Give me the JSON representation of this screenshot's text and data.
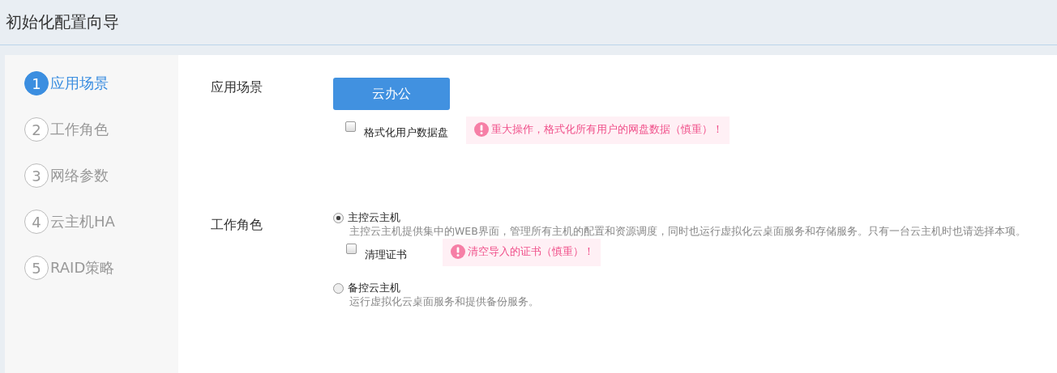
{
  "window": {
    "title": "初始化配置向导"
  },
  "steps": [
    {
      "number": "1",
      "label": "应用场景",
      "selected": true
    },
    {
      "number": "2",
      "label": "工作角色",
      "selected": false
    },
    {
      "number": "3",
      "label": "网络参数",
      "selected": false
    },
    {
      "number": "4",
      "label": "云主机HA",
      "selected": false
    },
    {
      "number": "5",
      "label": "RAID策略",
      "selected": false
    }
  ],
  "sections": [
    {
      "kind": "scene",
      "label": "应用场景",
      "button": "云办公",
      "option": {
        "label": "格式化用户数据盘",
        "checked": false
      },
      "warning": "重大操作，格式化所有用户的网盘数据（慎重）！"
    },
    {
      "kind": "roles",
      "label": "工作角色",
      "roles": [
        {
          "name": "主控云主机",
          "selected": true,
          "description": "主控云主机提供集中的WEB界面，管理所有主机的配置和资源调度，同时也运行虚拟化云桌面服务和存储服务。只有一台云主机时也请选择本项。",
          "option": {
            "label": "清理证书",
            "checked": false
          },
          "warning": "清空导入的证书（慎重）！"
        },
        {
          "name": "备控云主机",
          "selected": false,
          "description": "运行虚拟化云桌面服务和提供备份服务。"
        }
      ]
    }
  ]
}
